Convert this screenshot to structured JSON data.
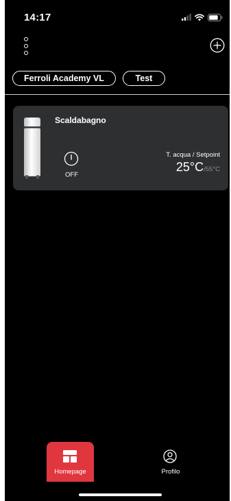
{
  "status_bar": {
    "time": "14:17",
    "icons": [
      "cellular-signal-icon",
      "wifi-icon",
      "battery-icon"
    ]
  },
  "header": {
    "menu_icon": "vertical-dots-icon",
    "add_icon": "add-circle-icon"
  },
  "locations": [
    {
      "label": "Ferroli Academy VL"
    },
    {
      "label": "Test"
    }
  ],
  "device": {
    "name": "Scaldabagno",
    "image_icon": "water-heater-icon",
    "power_icon": "power-icon",
    "power_state": "OFF",
    "temperature_label": "T. acqua / Setpoint",
    "current_temperature": "25°C",
    "setpoint": "/55°C"
  },
  "bottom_nav": {
    "items": [
      {
        "label": "Homepage",
        "icon": "homepage-grid-icon",
        "active": true
      },
      {
        "label": "Profilo",
        "icon": "user-profile-icon",
        "active": false
      }
    ]
  },
  "colors": {
    "background": "#000000",
    "card": "#2e2f31",
    "accent": "#e0373e",
    "muted_text": "#8e8f91"
  }
}
